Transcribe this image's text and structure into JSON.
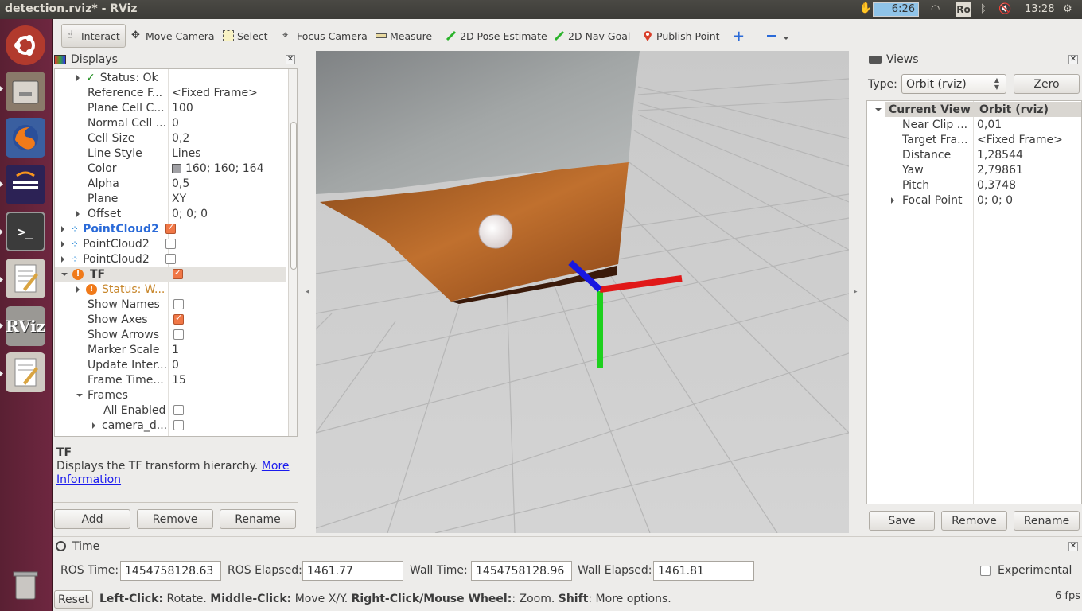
{
  "window": {
    "title": "detection.rviz* - RViz"
  },
  "tray": {
    "battery_time": "6:26",
    "keyboard_layout": "Ro",
    "clock": "13:28"
  },
  "toolbar": {
    "interact": "Interact",
    "move_camera": "Move Camera",
    "select": "Select",
    "focus_camera": "Focus Camera",
    "measure": "Measure",
    "pose_estimate": "2D Pose Estimate",
    "nav_goal": "2D Nav Goal",
    "publish_point": "Publish Point"
  },
  "displays": {
    "title": "Displays",
    "rows": [
      {
        "name": "Status: Ok",
        "value": ""
      },
      {
        "name": "Reference F...",
        "value": "<Fixed Frame>"
      },
      {
        "name": "Plane Cell C...",
        "value": "100"
      },
      {
        "name": "Normal Cell ...",
        "value": "0"
      },
      {
        "name": "Cell Size",
        "value": "0,2"
      },
      {
        "name": "Line Style",
        "value": "Lines"
      },
      {
        "name": "Color",
        "value": "160; 160; 164"
      },
      {
        "name": "Alpha",
        "value": "0,5"
      },
      {
        "name": "Plane",
        "value": "XY"
      },
      {
        "name": "Offset",
        "value": "0; 0; 0"
      },
      {
        "name": "PointCloud2",
        "value": ""
      },
      {
        "name": "PointCloud2",
        "value": ""
      },
      {
        "name": "PointCloud2",
        "value": ""
      },
      {
        "name": "TF",
        "value": ""
      },
      {
        "name": "Status: W...",
        "value": ""
      },
      {
        "name": "Show Names",
        "value": ""
      },
      {
        "name": "Show Axes",
        "value": ""
      },
      {
        "name": "Show Arrows",
        "value": ""
      },
      {
        "name": "Marker Scale",
        "value": "1"
      },
      {
        "name": "Update Inter...",
        "value": "0"
      },
      {
        "name": "Frame Time...",
        "value": "15"
      },
      {
        "name": "Frames",
        "value": ""
      },
      {
        "name": "All Enabled",
        "value": ""
      },
      {
        "name": "camera_d...",
        "value": ""
      }
    ],
    "desc_title": "TF",
    "desc_text": "Displays the TF transform hierarchy.",
    "desc_link": "More Information",
    "add": "Add",
    "remove": "Remove",
    "rename": "Rename"
  },
  "views": {
    "title": "Views",
    "type_label": "Type:",
    "type_value": "Orbit (rviz)",
    "zero": "Zero",
    "header_name": "Current View",
    "header_value": "Orbit (rviz)",
    "rows": [
      {
        "name": "Near Clip ...",
        "value": "0,01"
      },
      {
        "name": "Target Fra...",
        "value": "<Fixed Frame>"
      },
      {
        "name": "Distance",
        "value": "1,28544"
      },
      {
        "name": "Yaw",
        "value": "2,79861"
      },
      {
        "name": "Pitch",
        "value": "0,3748"
      },
      {
        "name": "Focal Point",
        "value": "0; 0; 0"
      }
    ],
    "save": "Save",
    "remove": "Remove",
    "rename": "Rename"
  },
  "time": {
    "title": "Time",
    "ros_time_label": "ROS Time:",
    "ros_time": "1454758128.63",
    "ros_elapsed_label": "ROS Elapsed:",
    "ros_elapsed": "1461.77",
    "wall_time_label": "Wall Time:",
    "wall_time": "1454758128.96",
    "wall_elapsed_label": "Wall Elapsed:",
    "wall_elapsed": "1461.81",
    "experimental": "Experimental"
  },
  "status": {
    "reset": "Reset",
    "left_b": "Left-Click:",
    "left_t": " Rotate. ",
    "middle_b": "Middle-Click:",
    "middle_t": " Move X/Y. ",
    "right_b": "Right-Click/Mouse Wheel:",
    "right_t": ": Zoom. ",
    "shift_b": "Shift",
    "shift_t": ": More options.",
    "fps": "6 fps"
  },
  "colors": {
    "accent": "#f07746",
    "launcher": "#6e2740",
    "link": "#1a1aee"
  }
}
